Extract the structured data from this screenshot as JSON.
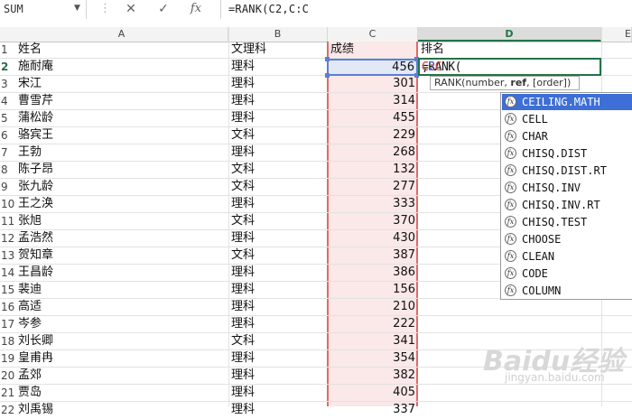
{
  "formula_bar": {
    "name_box": "SUM",
    "cancel_glyph": "✕",
    "enter_glyph": "✓",
    "fx_glyph": "fx",
    "formula": "=RANK(C2,C:C"
  },
  "columns": [
    "A",
    "B",
    "C",
    "D",
    "E"
  ],
  "headers": {
    "name": "姓名",
    "type": "文理科",
    "score": "成绩",
    "rank": "排名"
  },
  "rows": [
    {
      "n": "1"
    },
    {
      "n": "2",
      "name": "施耐庵",
      "type": "理科",
      "score": "456"
    },
    {
      "n": "3",
      "name": "宋江",
      "type": "理科",
      "score": "301"
    },
    {
      "n": "4",
      "name": "曹雪芹",
      "type": "理科",
      "score": "314"
    },
    {
      "n": "5",
      "name": "蒲松龄",
      "type": "理科",
      "score": "455"
    },
    {
      "n": "6",
      "name": "骆宾王",
      "type": "文科",
      "score": "229"
    },
    {
      "n": "7",
      "name": "王勃",
      "type": "理科",
      "score": "268"
    },
    {
      "n": "8",
      "name": "陈子昂",
      "type": "文科",
      "score": "132"
    },
    {
      "n": "9",
      "name": "张九龄",
      "type": "文科",
      "score": "277"
    },
    {
      "n": "10",
      "name": "王之涣",
      "type": "理科",
      "score": "333"
    },
    {
      "n": "11",
      "name": "张旭",
      "type": "文科",
      "score": "370"
    },
    {
      "n": "12",
      "name": "孟浩然",
      "type": "理科",
      "score": "430"
    },
    {
      "n": "13",
      "name": "贺知章",
      "type": "文科",
      "score": "387"
    },
    {
      "n": "14",
      "name": "王昌龄",
      "type": "理科",
      "score": "386"
    },
    {
      "n": "15",
      "name": "裴迪",
      "type": "理科",
      "score": "156"
    },
    {
      "n": "16",
      "name": "高适",
      "type": "理科",
      "score": "210"
    },
    {
      "n": "17",
      "name": "岑参",
      "type": "理科",
      "score": "222"
    },
    {
      "n": "18",
      "name": "刘长卿",
      "type": "文科",
      "score": "341"
    },
    {
      "n": "19",
      "name": "皇甫冉",
      "type": "理科",
      "score": "354"
    },
    {
      "n": "20",
      "name": "孟郊",
      "type": "理科",
      "score": "382"
    },
    {
      "n": "21",
      "name": "贾岛",
      "type": "理科",
      "score": "405"
    },
    {
      "n": "22",
      "name": "刘禹锡",
      "type": "理科",
      "score": "337"
    }
  ],
  "active_cell": {
    "prefix": "=RANK(",
    "ref1": "C2",
    "comma": ",",
    "ref2": "C:C"
  },
  "tooltip": {
    "func": "RANK(number, ",
    "bold_arg": "ref",
    "rest": ", [order])"
  },
  "autocomplete": [
    "CEILING.MATH",
    "CELL",
    "CHAR",
    "CHISQ.DIST",
    "CHISQ.DIST.RT",
    "CHISQ.INV",
    "CHISQ.INV.RT",
    "CHISQ.TEST",
    "CHOOSE",
    "CLEAN",
    "CODE",
    "COLUMN"
  ],
  "watermark": {
    "logo": "Baidu经验",
    "sub": "jingyan.baidu.com"
  },
  "colors": {
    "selection_green": "#217346",
    "ref_blue": "#5b7fd6",
    "ref_red": "#e06a6a",
    "list_highlight": "#3d6fd6"
  }
}
